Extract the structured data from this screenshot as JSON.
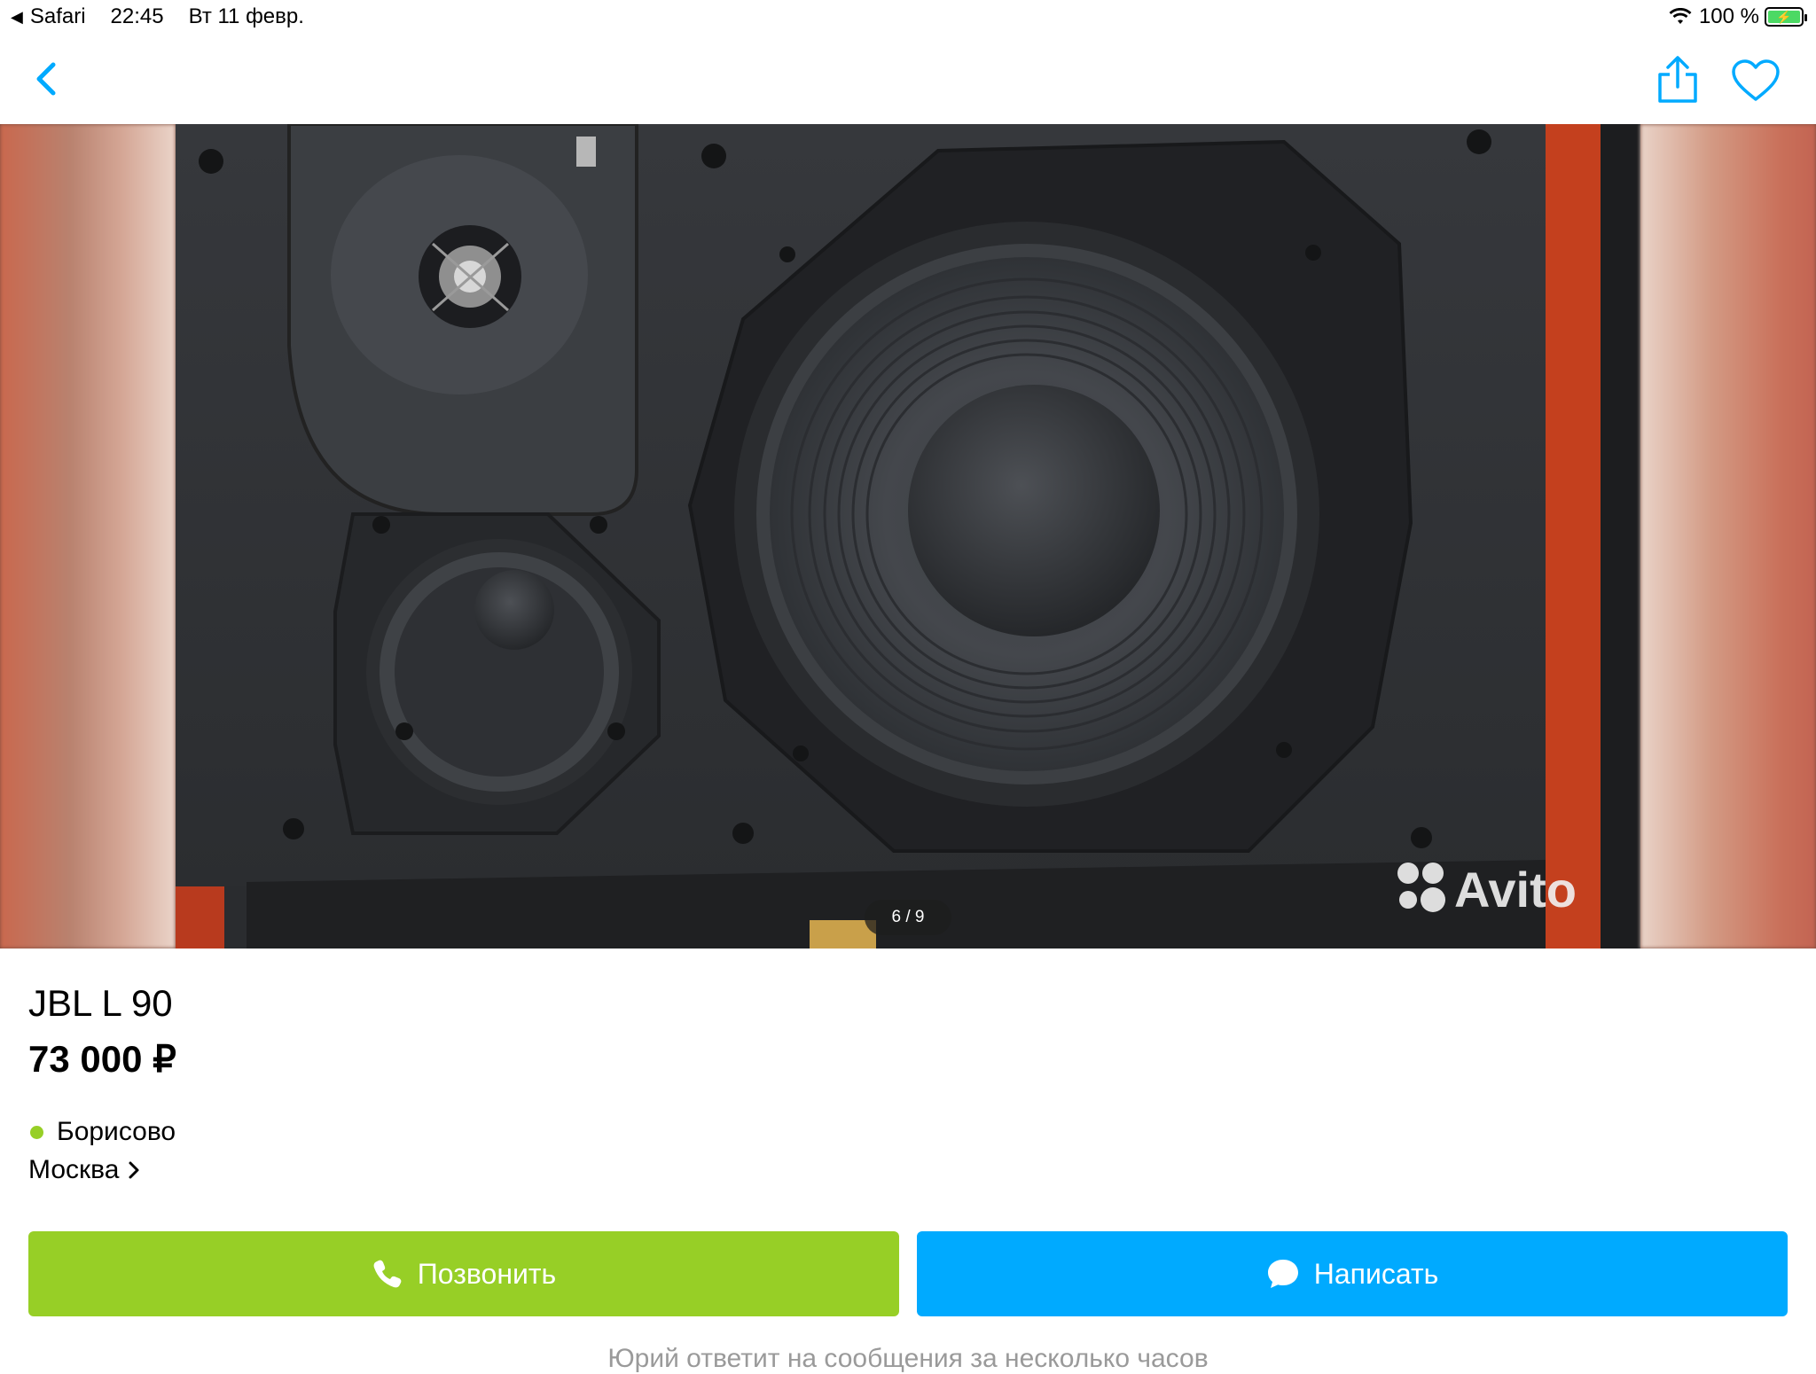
{
  "status_bar": {
    "back_app": "Safari",
    "time": "22:45",
    "date": "Вт 11 февр.",
    "battery": "100 %"
  },
  "icons": {
    "back": "chevron-left-icon",
    "share": "share-icon",
    "favorite": "heart-icon",
    "phone": "phone-icon",
    "chat": "chat-bubble-icon",
    "chevron": "chevron-right-icon"
  },
  "gallery": {
    "counter": "6 / 9",
    "watermark": "Avito"
  },
  "listing": {
    "title": "JBL L 90",
    "price": "73 000 ₽",
    "district": "Борисово",
    "city": "Москва"
  },
  "actions": {
    "call_label": "Позвонить",
    "message_label": "Написать"
  },
  "note": "Юрий ответит на сообщения за несколько часов",
  "colors": {
    "accent_blue": "#00aaff",
    "call_green": "#97cf26",
    "metro_dot": "#97cf26"
  }
}
